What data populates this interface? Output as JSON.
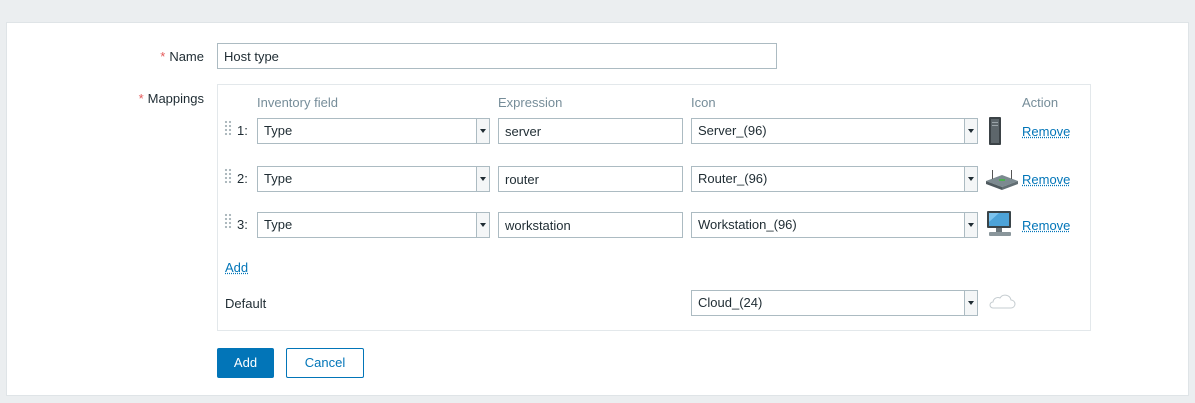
{
  "form": {
    "name_label": "Name",
    "name_value": "Host type",
    "mappings_label": "Mappings",
    "required_mark": "*"
  },
  "mappings": {
    "headers": {
      "inventory_field": "Inventory field",
      "expression": "Expression",
      "icon": "Icon",
      "action": "Action"
    },
    "rows": [
      {
        "num": "1:",
        "inventory_field": "Type",
        "expression": "server",
        "icon": "Server_(96)",
        "icon_name": "server-icon",
        "action": "Remove"
      },
      {
        "num": "2:",
        "inventory_field": "Type",
        "expression": "router",
        "icon": "Router_(96)",
        "icon_name": "router-icon",
        "action": "Remove"
      },
      {
        "num": "3:",
        "inventory_field": "Type",
        "expression": "workstation",
        "icon": "Workstation_(96)",
        "icon_name": "workstation-icon",
        "action": "Remove"
      }
    ],
    "add_link": "Add",
    "default_label": "Default",
    "default_icon": "Cloud_(24)",
    "default_icon_name": "cloud-icon"
  },
  "buttons": {
    "add": "Add",
    "cancel": "Cancel"
  },
  "colors": {
    "primary": "#0275b8",
    "required": "#e45959",
    "header_text": "#768d99"
  }
}
